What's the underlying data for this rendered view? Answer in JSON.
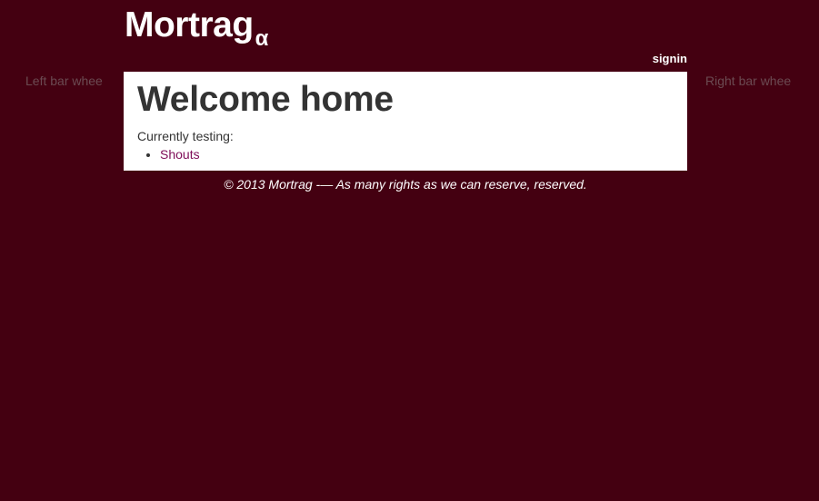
{
  "header": {
    "logo_text": "Mortrag",
    "logo_suffix": "α",
    "signin_label": "signin"
  },
  "sidebars": {
    "left_text": "Left bar whee",
    "right_text": "Right bar whee"
  },
  "main": {
    "title": "Welcome home",
    "testing_label": "Currently testing:",
    "testing_items": [
      {
        "label": "Shouts"
      }
    ]
  },
  "footer": {
    "text": "© 2013 Mortrag -— As many rights as we can reserve, reserved."
  },
  "colors": {
    "background": "#440011",
    "link": "#800f5a",
    "content_bg": "#ffffff"
  }
}
